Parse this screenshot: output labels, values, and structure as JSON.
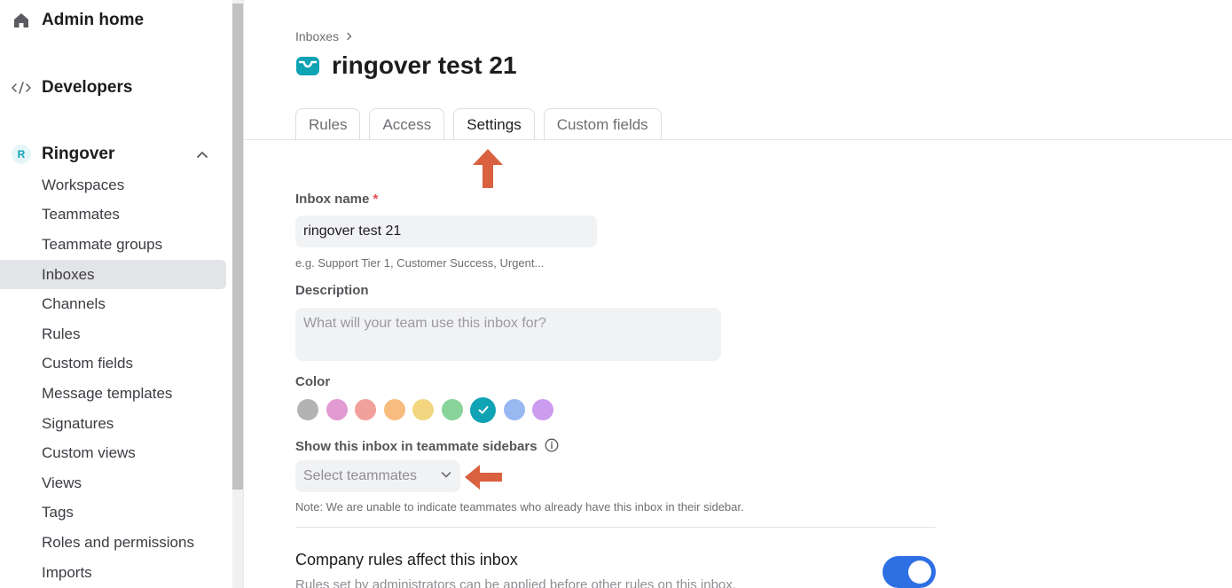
{
  "sidebar": {
    "admin_home": "Admin home",
    "developers": "Developers",
    "workspace": {
      "badge": "R",
      "name": "Ringover"
    },
    "items": [
      {
        "label": "Workspaces"
      },
      {
        "label": "Teammates"
      },
      {
        "label": "Teammate groups"
      },
      {
        "label": "Inboxes"
      },
      {
        "label": "Channels"
      },
      {
        "label": "Rules"
      },
      {
        "label": "Custom fields"
      },
      {
        "label": "Message templates"
      },
      {
        "label": "Signatures"
      },
      {
        "label": "Custom views"
      },
      {
        "label": "Views"
      },
      {
        "label": "Tags"
      },
      {
        "label": "Roles and permissions"
      },
      {
        "label": "Imports"
      }
    ],
    "active_item": "Inboxes"
  },
  "main": {
    "breadcrumb": "Inboxes",
    "title": "ringover test 21",
    "tabs": [
      {
        "label": "Rules"
      },
      {
        "label": "Access"
      },
      {
        "label": "Settings"
      },
      {
        "label": "Custom fields"
      }
    ],
    "active_tab": "Settings",
    "form": {
      "inbox_name_label": "Inbox name",
      "required_mark": "*",
      "inbox_name_value": "ringover test 21",
      "inbox_name_hint": "e.g. Support Tier 1, Customer Success, Urgent...",
      "description_label": "Description",
      "description_placeholder": "What will your team use this inbox for?",
      "color_label": "Color",
      "colors": [
        "#b3b3b3",
        "#e29ad2",
        "#f2a09c",
        "#f7bc7e",
        "#f2d67f",
        "#88d49a",
        "#0fa3b4",
        "#98b8f2",
        "#cc9cf0"
      ],
      "selected_color": "#0fa3b4",
      "sidebar_label": "Show this inbox in teammate sidebars",
      "select_placeholder": "Select teammates",
      "note": "Note: We are unable to indicate teammates who already have this inbox in their sidebar.",
      "company_rules_title": "Company rules affect this inbox",
      "company_rules_desc": "Rules set by administrators can be applied before other rules on this inbox.",
      "company_rules_enabled": true
    },
    "annotation_color": "#d9613f"
  }
}
